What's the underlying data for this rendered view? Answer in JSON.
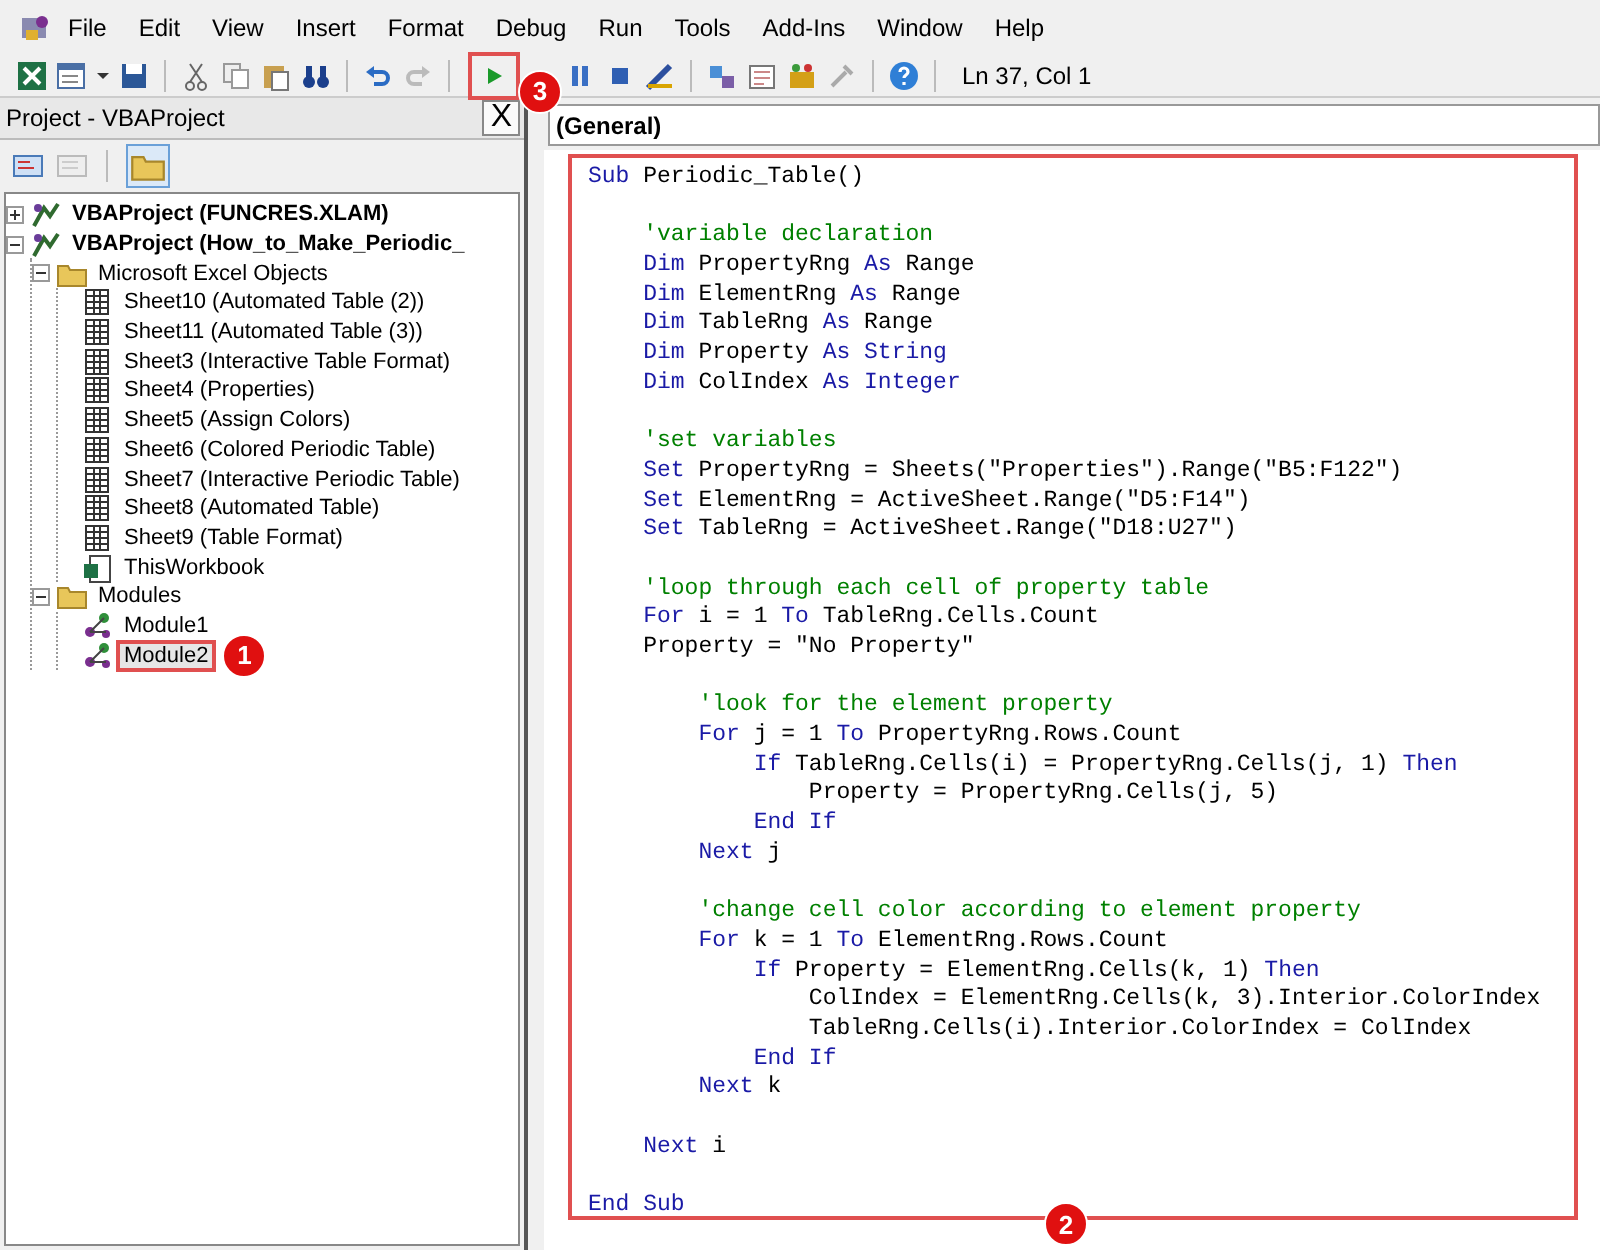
{
  "menu": [
    {
      "label": "File"
    },
    {
      "label": "Edit"
    },
    {
      "label": "View"
    },
    {
      "label": "Insert"
    },
    {
      "label": "Format"
    },
    {
      "label": "Debug"
    },
    {
      "label": "Run"
    },
    {
      "label": "Tools"
    },
    {
      "label": "Add-Ins"
    },
    {
      "label": "Window"
    },
    {
      "label": "Help"
    }
  ],
  "toolbar": {
    "run_callout": "3",
    "position": "Ln 37, Col 1"
  },
  "project_panel": {
    "title": "Project - VBAProject",
    "close": "X",
    "tree": [
      {
        "kind": "project",
        "label": "VBAProject (FUNCRES.XLAM)",
        "expanded": false,
        "selected": false
      },
      {
        "kind": "project",
        "label": "VBAProject (How_to_Make_Periodic_",
        "expanded": true,
        "selected": false,
        "children": [
          {
            "kind": "folder",
            "label": "Microsoft Excel Objects",
            "expanded": true,
            "selected": false,
            "children": [
              {
                "kind": "sheet",
                "label": "Sheet10 (Automated Table (2))",
                "selected": false
              },
              {
                "kind": "sheet",
                "label": "Sheet11 (Automated Table (3))",
                "selected": false
              },
              {
                "kind": "sheet",
                "label": "Sheet3 (Interactive Table Format)",
                "selected": false
              },
              {
                "kind": "sheet",
                "label": "Sheet4 (Properties)",
                "selected": false
              },
              {
                "kind": "sheet",
                "label": "Sheet5 (Assign Colors)",
                "selected": false
              },
              {
                "kind": "sheet",
                "label": "Sheet6 (Colored Periodic Table)",
                "selected": false
              },
              {
                "kind": "sheet",
                "label": "Sheet7 (Interactive Periodic Table)",
                "selected": false
              },
              {
                "kind": "sheet",
                "label": "Sheet8 (Automated Table)",
                "selected": false
              },
              {
                "kind": "sheet",
                "label": "Sheet9 (Table Format)",
                "selected": false
              },
              {
                "kind": "workbook",
                "label": "ThisWorkbook",
                "selected": false
              }
            ]
          },
          {
            "kind": "folder",
            "label": "Modules",
            "expanded": true,
            "selected": false,
            "children": [
              {
                "kind": "module",
                "label": "Module1",
                "selected": false
              },
              {
                "kind": "module",
                "label": "Module2",
                "selected": true,
                "callout": "1"
              }
            ]
          }
        ]
      }
    ]
  },
  "editor": {
    "object_box": "(General)",
    "callout": "2",
    "lines": [
      {
        "kind": "code",
        "segments": [
          {
            "kind": "keyword",
            "text": "Sub"
          },
          {
            "kind": "plain",
            "text": " Periodic_Table()"
          }
        ]
      },
      {
        "kind": "blank"
      },
      {
        "kind": "code",
        "segments": [
          {
            "kind": "comment",
            "text": "    'variable declaration"
          }
        ]
      },
      {
        "kind": "code",
        "segments": [
          {
            "kind": "keyword",
            "text": "    Dim"
          },
          {
            "kind": "plain",
            "text": " PropertyRng "
          },
          {
            "kind": "keyword",
            "text": "As"
          },
          {
            "kind": "plain",
            "text": " Range"
          }
        ]
      },
      {
        "kind": "code",
        "segments": [
          {
            "kind": "keyword",
            "text": "    Dim"
          },
          {
            "kind": "plain",
            "text": " ElementRng "
          },
          {
            "kind": "keyword",
            "text": "As"
          },
          {
            "kind": "plain",
            "text": " Range"
          }
        ]
      },
      {
        "kind": "code",
        "segments": [
          {
            "kind": "keyword",
            "text": "    Dim"
          },
          {
            "kind": "plain",
            "text": " TableRng "
          },
          {
            "kind": "keyword",
            "text": "As"
          },
          {
            "kind": "plain",
            "text": " Range"
          }
        ]
      },
      {
        "kind": "code",
        "segments": [
          {
            "kind": "keyword",
            "text": "    Dim"
          },
          {
            "kind": "plain",
            "text": " Property "
          },
          {
            "kind": "keyword",
            "text": "As String"
          }
        ]
      },
      {
        "kind": "code",
        "segments": [
          {
            "kind": "keyword",
            "text": "    Dim"
          },
          {
            "kind": "plain",
            "text": " ColIndex "
          },
          {
            "kind": "keyword",
            "text": "As Integer"
          }
        ]
      },
      {
        "kind": "blank"
      },
      {
        "kind": "code",
        "segments": [
          {
            "kind": "comment",
            "text": "    'set variables"
          }
        ]
      },
      {
        "kind": "code",
        "segments": [
          {
            "kind": "keyword",
            "text": "    Set"
          },
          {
            "kind": "plain",
            "text": " PropertyRng = Sheets(\"Properties\").Range(\"B5:F122\")"
          }
        ]
      },
      {
        "kind": "code",
        "segments": [
          {
            "kind": "keyword",
            "text": "    Set"
          },
          {
            "kind": "plain",
            "text": " ElementRng = ActiveSheet.Range(\"D5:F14\")"
          }
        ]
      },
      {
        "kind": "code",
        "segments": [
          {
            "kind": "keyword",
            "text": "    Set"
          },
          {
            "kind": "plain",
            "text": " TableRng = ActiveSheet.Range(\"D18:U27\")"
          }
        ]
      },
      {
        "kind": "blank"
      },
      {
        "kind": "code",
        "segments": [
          {
            "kind": "comment",
            "text": "    'loop through each cell of property table"
          }
        ]
      },
      {
        "kind": "code",
        "segments": [
          {
            "kind": "keyword",
            "text": "    For"
          },
          {
            "kind": "plain",
            "text": " i = 1 "
          },
          {
            "kind": "keyword",
            "text": "To"
          },
          {
            "kind": "plain",
            "text": " TableRng.Cells.Count"
          }
        ]
      },
      {
        "kind": "code",
        "segments": [
          {
            "kind": "plain",
            "text": "    Property = \"No Property\""
          }
        ]
      },
      {
        "kind": "blank"
      },
      {
        "kind": "code",
        "segments": [
          {
            "kind": "comment",
            "text": "        'look for the element property"
          }
        ]
      },
      {
        "kind": "code",
        "segments": [
          {
            "kind": "keyword",
            "text": "        For"
          },
          {
            "kind": "plain",
            "text": " j = 1 "
          },
          {
            "kind": "keyword",
            "text": "To"
          },
          {
            "kind": "plain",
            "text": " PropertyRng.Rows.Count"
          }
        ]
      },
      {
        "kind": "code",
        "segments": [
          {
            "kind": "keyword",
            "text": "            If"
          },
          {
            "kind": "plain",
            "text": " TableRng.Cells(i) = PropertyRng.Cells(j, 1) "
          },
          {
            "kind": "keyword",
            "text": "Then"
          }
        ]
      },
      {
        "kind": "code",
        "segments": [
          {
            "kind": "plain",
            "text": "                Property = PropertyRng.Cells(j, 5)"
          }
        ]
      },
      {
        "kind": "code",
        "segments": [
          {
            "kind": "keyword",
            "text": "            End If"
          }
        ]
      },
      {
        "kind": "code",
        "segments": [
          {
            "kind": "keyword",
            "text": "        Next"
          },
          {
            "kind": "plain",
            "text": " j"
          }
        ]
      },
      {
        "kind": "blank"
      },
      {
        "kind": "code",
        "segments": [
          {
            "kind": "comment",
            "text": "        'change cell color according to element property"
          }
        ]
      },
      {
        "kind": "code",
        "segments": [
          {
            "kind": "keyword",
            "text": "        For"
          },
          {
            "kind": "plain",
            "text": " k = 1 "
          },
          {
            "kind": "keyword",
            "text": "To"
          },
          {
            "kind": "plain",
            "text": " ElementRng.Rows.Count"
          }
        ]
      },
      {
        "kind": "code",
        "segments": [
          {
            "kind": "keyword",
            "text": "            If"
          },
          {
            "kind": "plain",
            "text": " Property = ElementRng.Cells(k, 1) "
          },
          {
            "kind": "keyword",
            "text": "Then"
          }
        ]
      },
      {
        "kind": "code",
        "segments": [
          {
            "kind": "plain",
            "text": "                ColIndex = ElementRng.Cells(k, 3).Interior.ColorIndex"
          }
        ]
      },
      {
        "kind": "code",
        "segments": [
          {
            "kind": "plain",
            "text": "                TableRng.Cells(i).Interior.ColorIndex = ColIndex"
          }
        ]
      },
      {
        "kind": "code",
        "segments": [
          {
            "kind": "keyword",
            "text": "            End If"
          }
        ]
      },
      {
        "kind": "code",
        "segments": [
          {
            "kind": "keyword",
            "text": "        Next"
          },
          {
            "kind": "plain",
            "text": " k"
          }
        ]
      },
      {
        "kind": "blank"
      },
      {
        "kind": "code",
        "segments": [
          {
            "kind": "keyword",
            "text": "    Next"
          },
          {
            "kind": "plain",
            "text": " i"
          }
        ]
      },
      {
        "kind": "blank"
      },
      {
        "kind": "code",
        "segments": [
          {
            "kind": "keyword",
            "text": "End Sub"
          }
        ]
      }
    ]
  }
}
